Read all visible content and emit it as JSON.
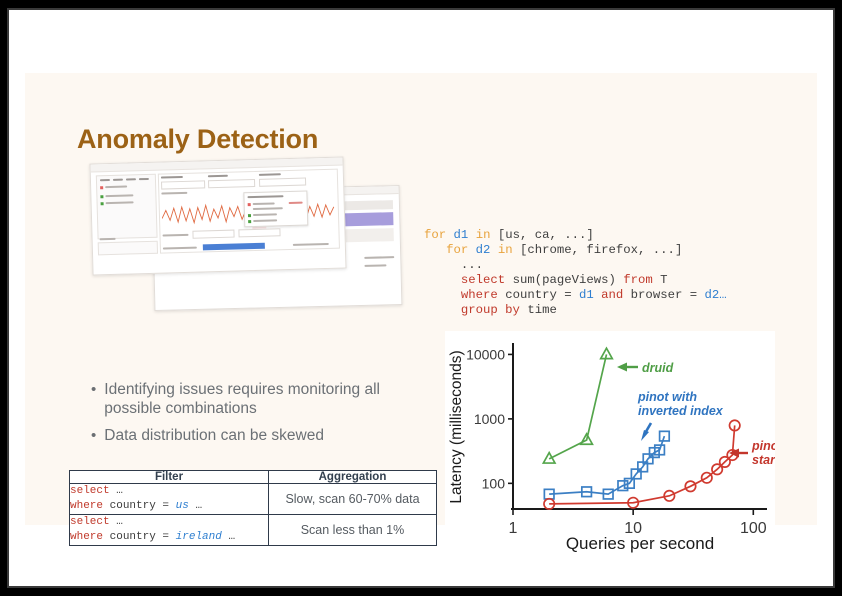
{
  "slide": {
    "title": "Anomaly Detection"
  },
  "bullets": [
    "Identifying issues requires monitoring all possible combinations",
    "Data distribution can be skewed"
  ],
  "table": {
    "headers": [
      "Filter",
      "Aggregation"
    ],
    "rows": [
      {
        "filter_line1_kw": "select",
        "filter_line1_rest": " …",
        "filter_line2_kw": "where",
        "filter_line2_mid": " country = ",
        "filter_line2_val": "us",
        "filter_line2_tail": " …",
        "aggregation": "Slow, scan 60-70% data"
      },
      {
        "filter_line1_kw": "select",
        "filter_line1_rest": " …",
        "filter_line2_kw": "where",
        "filter_line2_mid": " country = ",
        "filter_line2_val": "ireland",
        "filter_line2_tail": " …",
        "aggregation": "Scan less than 1%"
      }
    ]
  },
  "code": {
    "lines": [
      [
        {
          "t": "for ",
          "c": "for"
        },
        {
          "t": "d1",
          "c": "var"
        },
        {
          "t": " ",
          "c": "pl"
        },
        {
          "t": "in",
          "c": "for"
        },
        {
          "t": " [us, ca, ...]",
          "c": "pl"
        }
      ],
      [
        {
          "t": "   ",
          "c": "pl"
        },
        {
          "t": "for ",
          "c": "for"
        },
        {
          "t": "d2",
          "c": "var"
        },
        {
          "t": " ",
          "c": "pl"
        },
        {
          "t": "in",
          "c": "for"
        },
        {
          "t": " [chrome, firefox, ...]",
          "c": "pl"
        }
      ],
      [
        {
          "t": "     ...",
          "c": "pl"
        }
      ],
      [
        {
          "t": "     ",
          "c": "pl"
        },
        {
          "t": "select",
          "c": "sql"
        },
        {
          "t": " sum(pageViews) ",
          "c": "pl"
        },
        {
          "t": "from",
          "c": "sql"
        },
        {
          "t": " T",
          "c": "pl"
        }
      ],
      [
        {
          "t": "     ",
          "c": "pl"
        },
        {
          "t": "where",
          "c": "sql"
        },
        {
          "t": " country = ",
          "c": "pl"
        },
        {
          "t": "d1",
          "c": "var"
        },
        {
          "t": " ",
          "c": "pl"
        },
        {
          "t": "and",
          "c": "sql"
        },
        {
          "t": " browser = ",
          "c": "pl"
        },
        {
          "t": "d2…",
          "c": "var"
        }
      ],
      [
        {
          "t": "     ",
          "c": "pl"
        },
        {
          "t": "group by",
          "c": "sql"
        },
        {
          "t": " time",
          "c": "pl"
        }
      ]
    ]
  },
  "chart_data": {
    "type": "line",
    "title": "",
    "xlabel": "Queries per second",
    "ylabel": "Latency (milliseconds)",
    "xscale": "log",
    "yscale": "log",
    "xlim": [
      1,
      130
    ],
    "ylim": [
      40,
      14000
    ],
    "xticks": [
      1,
      10,
      100
    ],
    "xticklabels": [
      "1",
      "10",
      "100"
    ],
    "yticks": [
      100,
      1000,
      10000
    ],
    "yticklabels": [
      "100",
      "1000",
      "10000"
    ],
    "grid": false,
    "legend": "annotations",
    "series": [
      {
        "name": "druid",
        "color": "#54a54b",
        "marker": "triangle",
        "annotation": "druid",
        "x": [
          2.0,
          4.1,
          6.0
        ],
        "y": [
          240,
          470,
          10000
        ]
      },
      {
        "name": "pinot with inverted index",
        "color": "#3b7fc4",
        "marker": "square",
        "annotation": "pinot with\ninverted index",
        "x": [
          2.0,
          4.1,
          6.2,
          8.2,
          9.3,
          10.6,
          12.0,
          13.3,
          15.0,
          16.6,
          18.2
        ],
        "y": [
          68,
          74,
          68,
          92,
          100,
          140,
          180,
          240,
          300,
          330,
          540
        ]
      },
      {
        "name": "pinot with startree index",
        "color": "#d03a2f",
        "marker": "circle",
        "annotation": "pinot with\nstartree index",
        "x": [
          2.0,
          10.0,
          20.0,
          30.0,
          41.0,
          50.0,
          58.0,
          67.0,
          70.0
        ],
        "y": [
          48,
          50,
          64,
          90,
          122,
          165,
          215,
          275,
          790
        ]
      }
    ],
    "annotations": [
      {
        "text": "druid",
        "color": "#4f9e46",
        "arrow": "left"
      },
      {
        "text": "pinot with inverted index",
        "color": "#2f74c0",
        "arrow": "down-left"
      },
      {
        "text": "pinot with startree index",
        "color": "#c3362c",
        "arrow": "left"
      }
    ]
  },
  "dashboard": {
    "caption": "analytics-dashboard-screenshots"
  },
  "colors": {
    "title": "#9c6216",
    "slide_bg": "#fdf8f2",
    "page_bg": "#ffffff",
    "border": "#3a3a3a",
    "druid": "#54a54b",
    "inverted": "#3b7fc4",
    "startree": "#d03a2f"
  }
}
